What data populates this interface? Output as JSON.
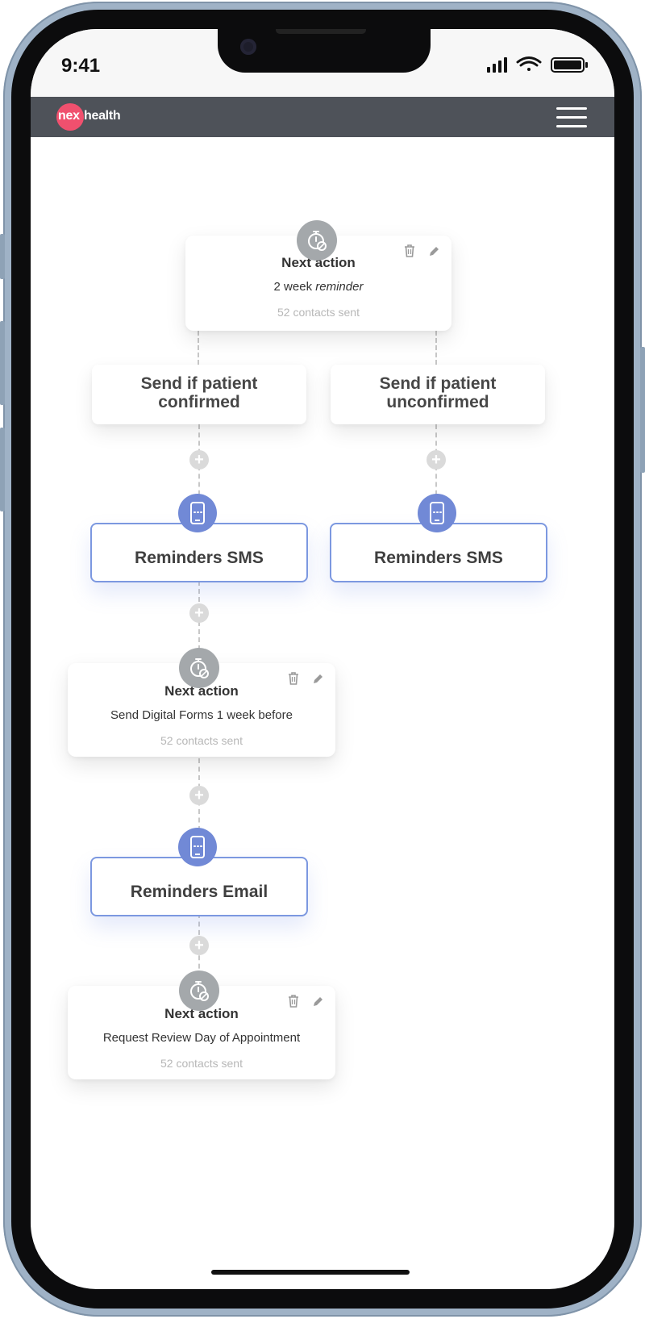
{
  "status_bar": {
    "time": "9:41"
  },
  "app_bar": {
    "logo_prefix": "nex",
    "logo_suffix": "health",
    "menu_icon": "hamburger-menu-icon"
  },
  "colors": {
    "brand_pink": "#f0506e",
    "app_bar": "#4e5259",
    "channel_blue": "#7c98e0",
    "badge_blue": "#7189d6",
    "badge_gray": "#a4a8ab"
  },
  "flow": {
    "step1": {
      "title": "Next action",
      "desc_prefix": "2 week ",
      "desc_emphasis": "reminder",
      "sent": "52 contacts sent"
    },
    "branch_confirmed": {
      "line1": "Send if patient",
      "line2": "confirmed",
      "channel": "Reminders SMS"
    },
    "branch_unconfirmed": {
      "line1": "Send if patient",
      "line2": "unconfirmed",
      "channel": "Reminders SMS"
    },
    "step2": {
      "title": "Next action",
      "desc": "Send Digital Forms 1 week before",
      "sent": "52 contacts sent"
    },
    "email_channel": {
      "label": "Reminders Email"
    },
    "step3": {
      "title": "Next action",
      "desc": "Request Review Day of Appointment",
      "sent": "52 contacts sent"
    },
    "add_step_symbol": "+"
  }
}
